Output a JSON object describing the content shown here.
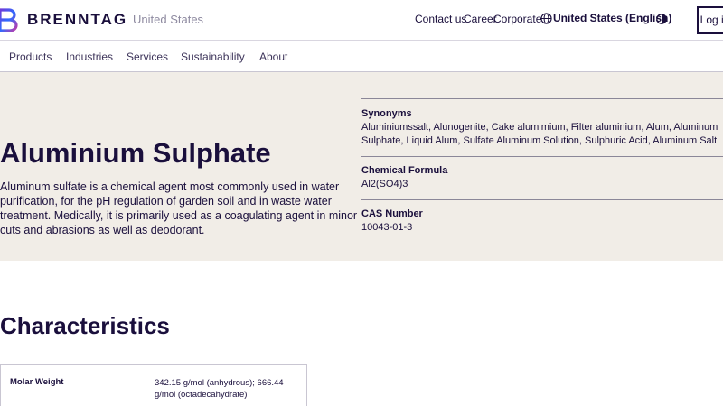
{
  "header": {
    "brand": "BRENNTAG",
    "country": "United States",
    "links": [
      "Contact us",
      "Career",
      "Corporate"
    ],
    "language": "United States (English)",
    "login": "Log in",
    "icons": [
      "brenntag-logo-icon",
      "globe-icon",
      "contrast-icon"
    ],
    "accent_colors": [
      "#1a0f3c",
      "#6f3bd9",
      "#2f6bff",
      "#c23aa8"
    ]
  },
  "nav": {
    "items": [
      "Products",
      "Industries",
      "Services",
      "Sustainability",
      "About"
    ]
  },
  "product": {
    "title": "Aluminium Sulphate",
    "description": "Aluminum sulfate is a chemical agent most commonly used in water purification, for the pH regulation of garden soil and in waste water treatment. Medically, it is primarily used as a coagulating agent in minor cuts and abrasions as well as deodorant.",
    "synonyms_label": "Synonyms",
    "synonyms_line1": "Aluminiumssalt, Alunogenite, Cake alumimium, Filter aluminium, Alum, Aluminum",
    "synonyms_line2": "Sulphate, Liquid Alum, Sulfate Aluminum Solution, Sulphuric Acid, Aluminum Salt",
    "formula_label": "Chemical Formula",
    "formula_value": "Al2(SO4)3",
    "cas_label": "CAS Number",
    "cas_value": "10043-01-3",
    "hero_background": "#f1ede7"
  },
  "characteristics": {
    "heading": "Characteristics",
    "rows": [
      {
        "label": "Molar Weight",
        "value": "342.15 g/mol (anhydrous); 666.44 g/mol (octadecahydrate)"
      }
    ]
  }
}
